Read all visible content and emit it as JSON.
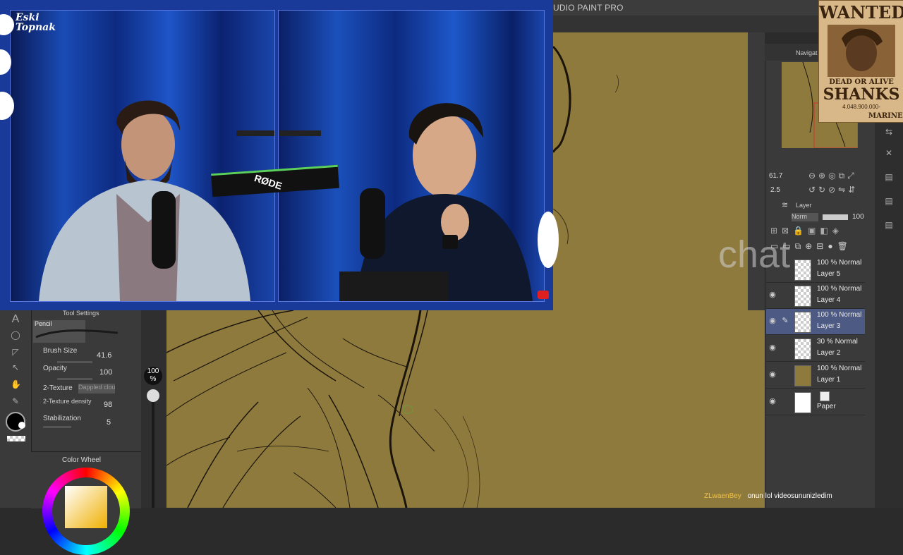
{
  "app": {
    "title": "UDIO PAINT PRO"
  },
  "navigator": {
    "label": "Navigat",
    "zoom": "61.7",
    "rotate": "2.5"
  },
  "layer_panel": {
    "tab_label": "Layer",
    "blend_mode": "Norm",
    "opacity": "100",
    "layers": [
      {
        "blend": "100 % Normal",
        "name": "Layer 5",
        "active": false
      },
      {
        "blend": "100 % Normal",
        "name": "Layer 4",
        "active": false
      },
      {
        "blend": "100 % Normal",
        "name": "Layer 3",
        "active": true
      },
      {
        "blend": "30 % Normal",
        "name": "Layer 2",
        "active": false
      },
      {
        "blend": "100 % Normal",
        "name": "Layer 1",
        "active": false
      },
      {
        "blend": "",
        "name": "Paper",
        "active": false
      }
    ]
  },
  "tool_settings": {
    "title": "Tool Settings",
    "brush_name": "Pencil",
    "brush_size": {
      "label": "Brush Size",
      "value": "41.6"
    },
    "opacity": {
      "label": "Opacity",
      "value": "100"
    },
    "texture": {
      "label": "2-Texture",
      "value": "Dappled clou"
    },
    "texture_density": {
      "label": "2-Texture density",
      "value": "98"
    },
    "stabilization": {
      "label": "Stabilization",
      "value": "5"
    }
  },
  "color_wheel": {
    "title": "Color Wheel"
  },
  "zoom_indicator": {
    "value": "100",
    "unit": "%"
  },
  "stream": {
    "logo_line1": "Eski",
    "logo_line2": "Topnak",
    "mic_brand": "RØDE",
    "watermark": "chat",
    "chat": {
      "user": "ZLwaenBey",
      "message": "onun lol videosununizledim"
    }
  },
  "wanted_poster": {
    "title": "WANTED",
    "subtitle": "DEAD OR ALIVE",
    "name": "SHANKS",
    "bounty": "4.048.900.000-",
    "footer": "MARINE"
  },
  "colors": {
    "canvas": "#8f7a3e",
    "active_layer": "#4c5a84",
    "video_frame": "#1a3a9a",
    "chat_user": "#f0c040"
  }
}
